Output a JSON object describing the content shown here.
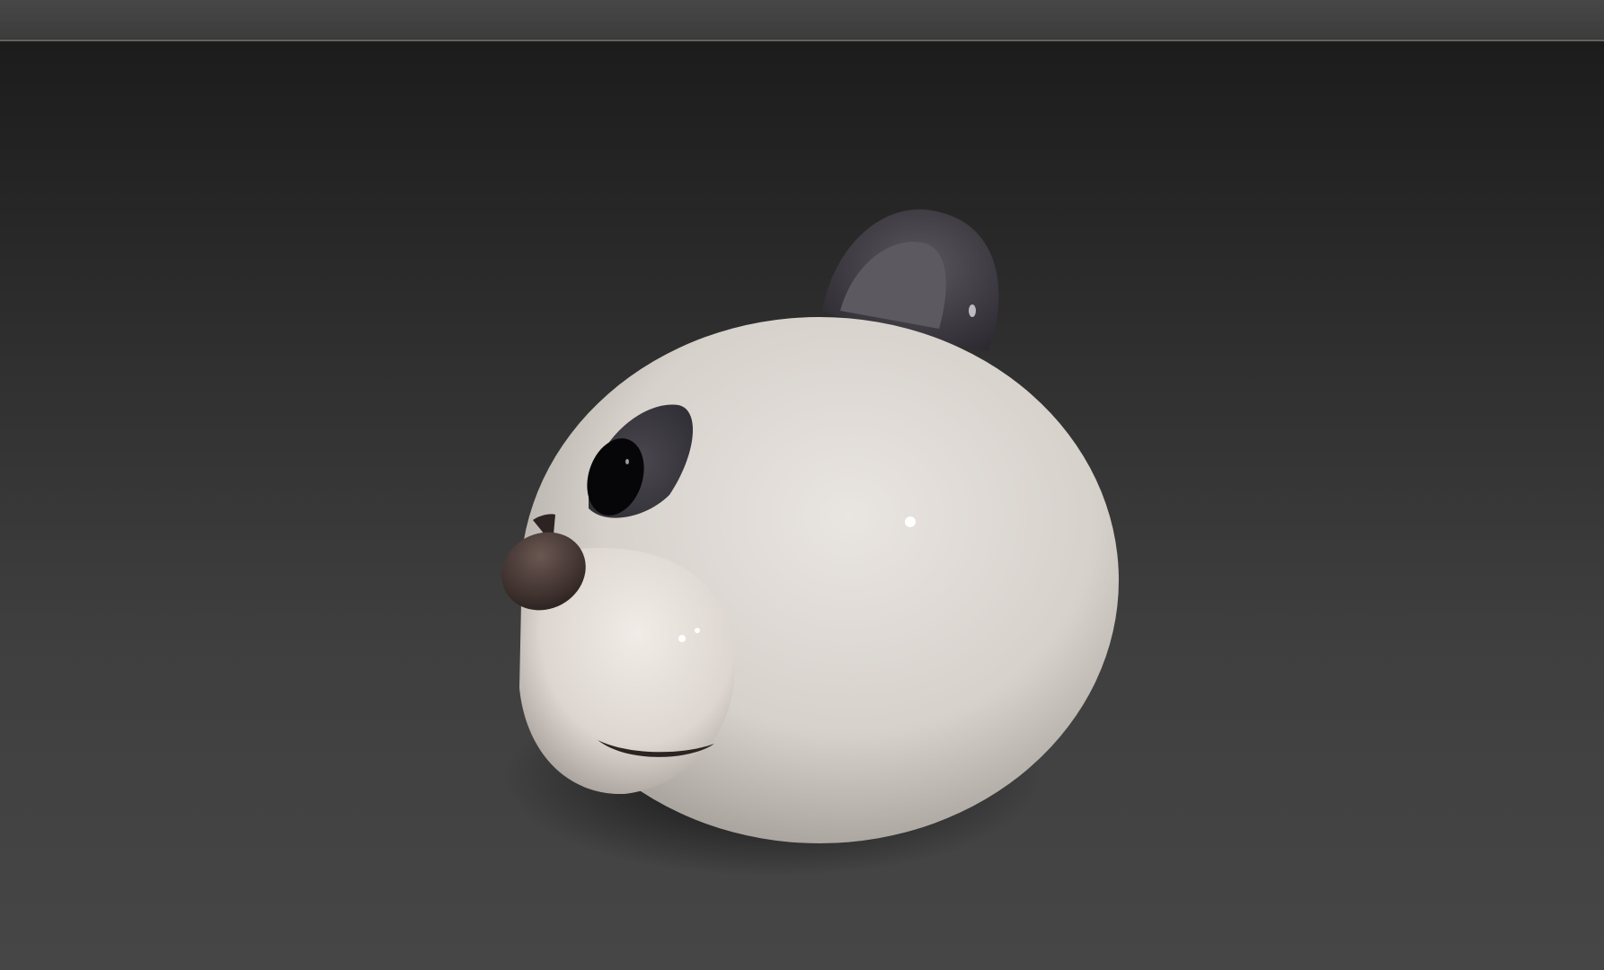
{
  "app": {
    "title": "",
    "top_bar": {
      "background": "#424242",
      "divider_color": "#6a6a6a"
    }
  },
  "viewport": {
    "background_top": "#1c1c1c",
    "background_bottom": "#464646",
    "model": {
      "name": "",
      "icon": "panda-head-model",
      "parts": [
        "head",
        "ear",
        "eye-patch",
        "eye",
        "nose",
        "muzzle",
        "mouth"
      ],
      "colors": {
        "fur_white": "#e2ddd8",
        "fur_black": "#3e3c42",
        "nose": "#4a3a36",
        "eye": "#0a0a0c",
        "shadow": "#111111"
      }
    }
  }
}
